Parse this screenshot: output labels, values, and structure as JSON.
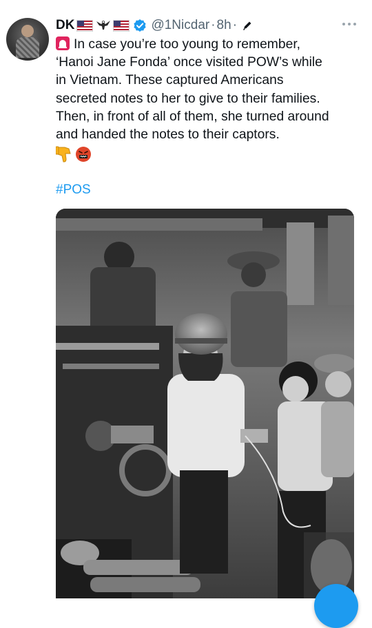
{
  "author": {
    "display_name": "DK",
    "handle": "@1Nicdar",
    "separator": "·",
    "time": "8h",
    "trailing_separator": "·",
    "name_decorations": [
      "us-flag-icon",
      "eagle-icon",
      "us-flag-icon"
    ],
    "verified": true
  },
  "tweet": {
    "lines": [
      "In case you’re too young to remember,",
      "‘Hanoi Jane Fonda’ once visited POW’s while",
      "in Vietnam. These captured Americans",
      "secreted notes to her to give to their families.",
      "Then, in front of all of them, she turned around",
      "and handed the notes to their captors."
    ],
    "leading_emoji": "siren-icon",
    "emojis": [
      "thumbs-down-icon",
      "swearing-face-icon"
    ],
    "hashtag": "#POS"
  },
  "colors": {
    "text": "#0f1419",
    "secondary": "#536471",
    "accent": "#1d9bf0",
    "verified": "#1d9bf0"
  }
}
